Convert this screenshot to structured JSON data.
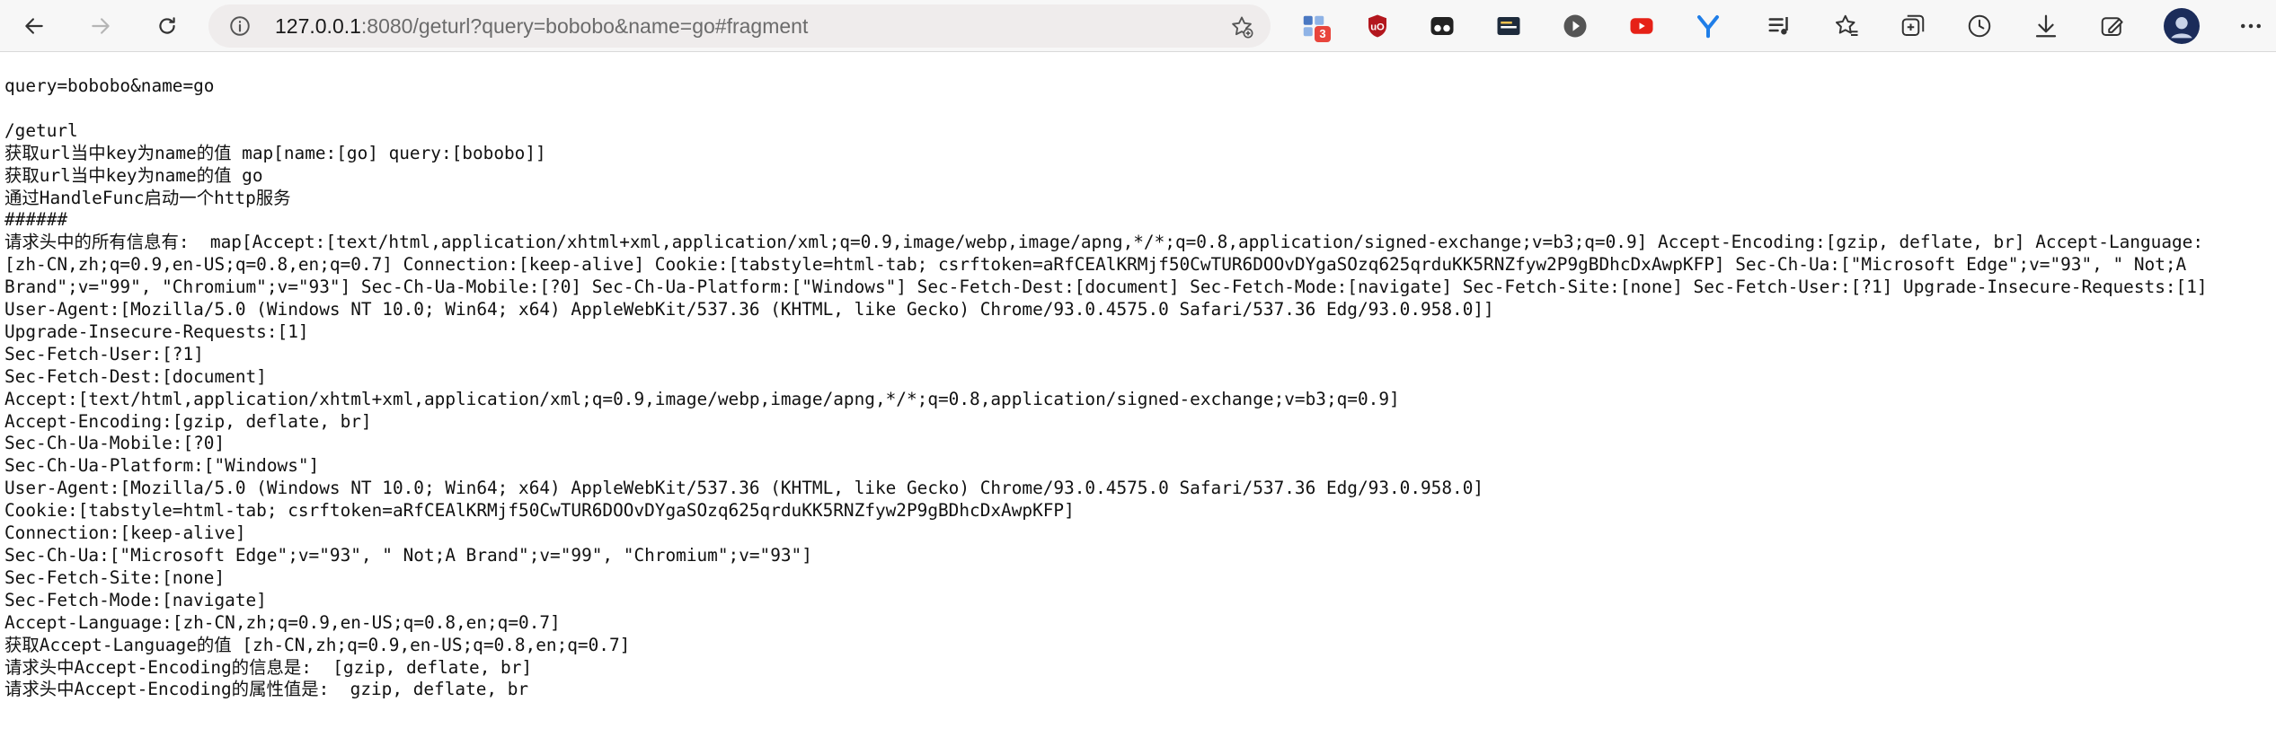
{
  "browser": {
    "url_host": "127.0.0.1",
    "url_rest": ":8080/geturl?query=bobobo&name=go#fragment",
    "extension_badge": "3"
  },
  "icons": {
    "back": "back-arrow-icon",
    "forward": "forward-arrow-icon",
    "refresh": "refresh-icon",
    "info": "site-info-icon",
    "favorite": "add-favorite-icon",
    "extensions": "extensions-icon",
    "ublock": "ublock-origin-icon",
    "tampermonkey": "tampermonkey-icon",
    "reader": "reader-icon",
    "play": "play-icon",
    "youtube": "youtube-icon",
    "ext_y": "y-extension-icon",
    "media": "media-control-icon",
    "favorites": "favorites-icon",
    "collections": "collections-icon",
    "history": "history-icon",
    "downloads": "downloads-icon",
    "screenshot": "web-capture-icon",
    "profile": "profile-avatar-icon",
    "menu": "more-menu-icon"
  },
  "colors": {
    "ublock": "#b3171e",
    "youtube": "#e62117",
    "y_ext": "#1f7ee8",
    "avatar": "#1b2c5a",
    "urlbar": "#efecec"
  },
  "page": {
    "lines": [
      "query=bobobo&name=go",
      "",
      "/geturl",
      "获取url当中key为name的值 map[name:[go] query:[bobobo]]",
      "获取url当中key为name的值 go",
      "通过HandleFunc启动一个http服务",
      "######",
      "请求头中的所有信息有:  map[Accept:[text/html,application/xhtml+xml,application/xml;q=0.9,image/webp,image/apng,*/*;q=0.8,application/signed-exchange;v=b3;q=0.9] Accept-Encoding:[gzip, deflate, br] Accept-Language:",
      "[zh-CN,zh;q=0.9,en-US;q=0.8,en;q=0.7] Connection:[keep-alive] Cookie:[tabstyle=html-tab; csrftoken=aRfCEAlKRMjf50CwTUR6DOOvDYgaSOzq625qrduKK5RNZfyw2P9gBDhcDxAwpKFP] Sec-Ch-Ua:[\"Microsoft Edge\";v=\"93\", \" Not;A",
      "Brand\";v=\"99\", \"Chromium\";v=\"93\"] Sec-Ch-Ua-Mobile:[?0] Sec-Ch-Ua-Platform:[\"Windows\"] Sec-Fetch-Dest:[document] Sec-Fetch-Mode:[navigate] Sec-Fetch-Site:[none] Sec-Fetch-User:[?1] Upgrade-Insecure-Requests:[1]",
      "User-Agent:[Mozilla/5.0 (Windows NT 10.0; Win64; x64) AppleWebKit/537.36 (KHTML, like Gecko) Chrome/93.0.4575.0 Safari/537.36 Edg/93.0.958.0]]",
      "Upgrade-Insecure-Requests:[1]",
      "Sec-Fetch-User:[?1]",
      "Sec-Fetch-Dest:[document]",
      "Accept:[text/html,application/xhtml+xml,application/xml;q=0.9,image/webp,image/apng,*/*;q=0.8,application/signed-exchange;v=b3;q=0.9]",
      "Accept-Encoding:[gzip, deflate, br]",
      "Sec-Ch-Ua-Mobile:[?0]",
      "Sec-Ch-Ua-Platform:[\"Windows\"]",
      "User-Agent:[Mozilla/5.0 (Windows NT 10.0; Win64; x64) AppleWebKit/537.36 (KHTML, like Gecko) Chrome/93.0.4575.0 Safari/537.36 Edg/93.0.958.0]",
      "Cookie:[tabstyle=html-tab; csrftoken=aRfCEAlKRMjf50CwTUR6DOOvDYgaSOzq625qrduKK5RNZfyw2P9gBDhcDxAwpKFP]",
      "Connection:[keep-alive]",
      "Sec-Ch-Ua:[\"Microsoft Edge\";v=\"93\", \" Not;A Brand\";v=\"99\", \"Chromium\";v=\"93\"]",
      "Sec-Fetch-Site:[none]",
      "Sec-Fetch-Mode:[navigate]",
      "Accept-Language:[zh-CN,zh;q=0.9,en-US;q=0.8,en;q=0.7]",
      "获取Accept-Language的值 [zh-CN,zh;q=0.9,en-US;q=0.8,en;q=0.7]",
      "请求头中Accept-Encoding的信息是:  [gzip, deflate, br]",
      "请求头中Accept-Encoding的属性值是:  gzip, deflate, br"
    ]
  }
}
